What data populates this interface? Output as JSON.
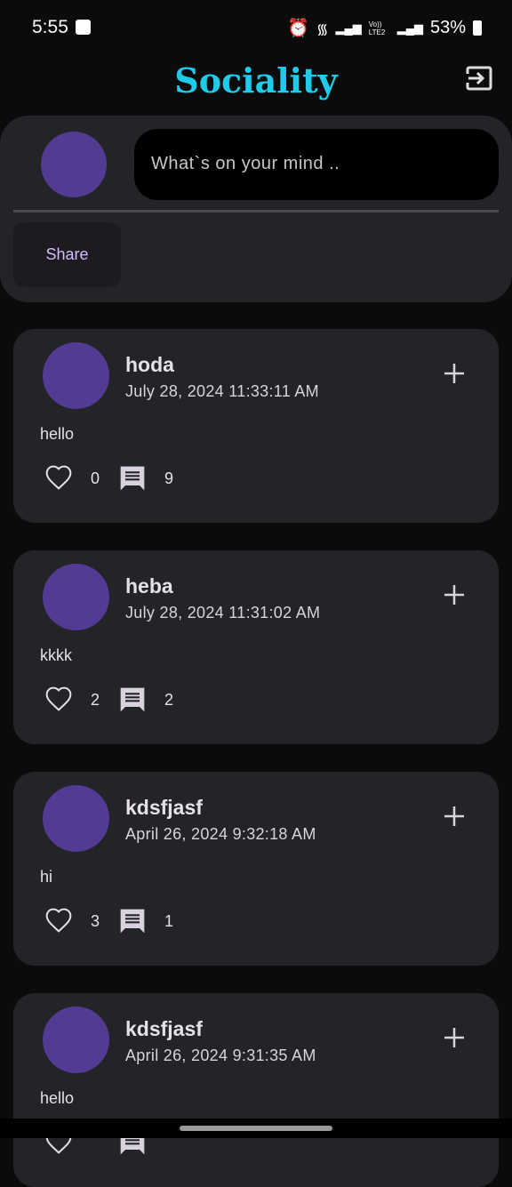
{
  "status": {
    "time": "5:55",
    "network": "Vo)) LTE2",
    "battery": "53%"
  },
  "app": {
    "title": "Sociality"
  },
  "composer": {
    "placeholder": "What`s on your mind ..",
    "share_label": "Share"
  },
  "posts": [
    {
      "name": "hoda",
      "date": "July 28, 2024 11:33:11 AM",
      "body": "hello",
      "likes": "0",
      "comments": "9"
    },
    {
      "name": "heba",
      "date": "July 28, 2024 11:31:02 AM",
      "body": "kkkk",
      "likes": "2",
      "comments": "2"
    },
    {
      "name": "kdsfjasf",
      "date": "April 26, 2024 9:32:18 AM",
      "body": "hi",
      "likes": "3",
      "comments": "1"
    },
    {
      "name": "kdsfjasf",
      "date": "April 26, 2024 9:31:35 AM",
      "body": "hello",
      "likes": "",
      "comments": ""
    }
  ],
  "colors": {
    "accent": "#1ecbe9",
    "avatar": "#533b93",
    "card": "#232427",
    "share_text": "#d0bcff"
  }
}
